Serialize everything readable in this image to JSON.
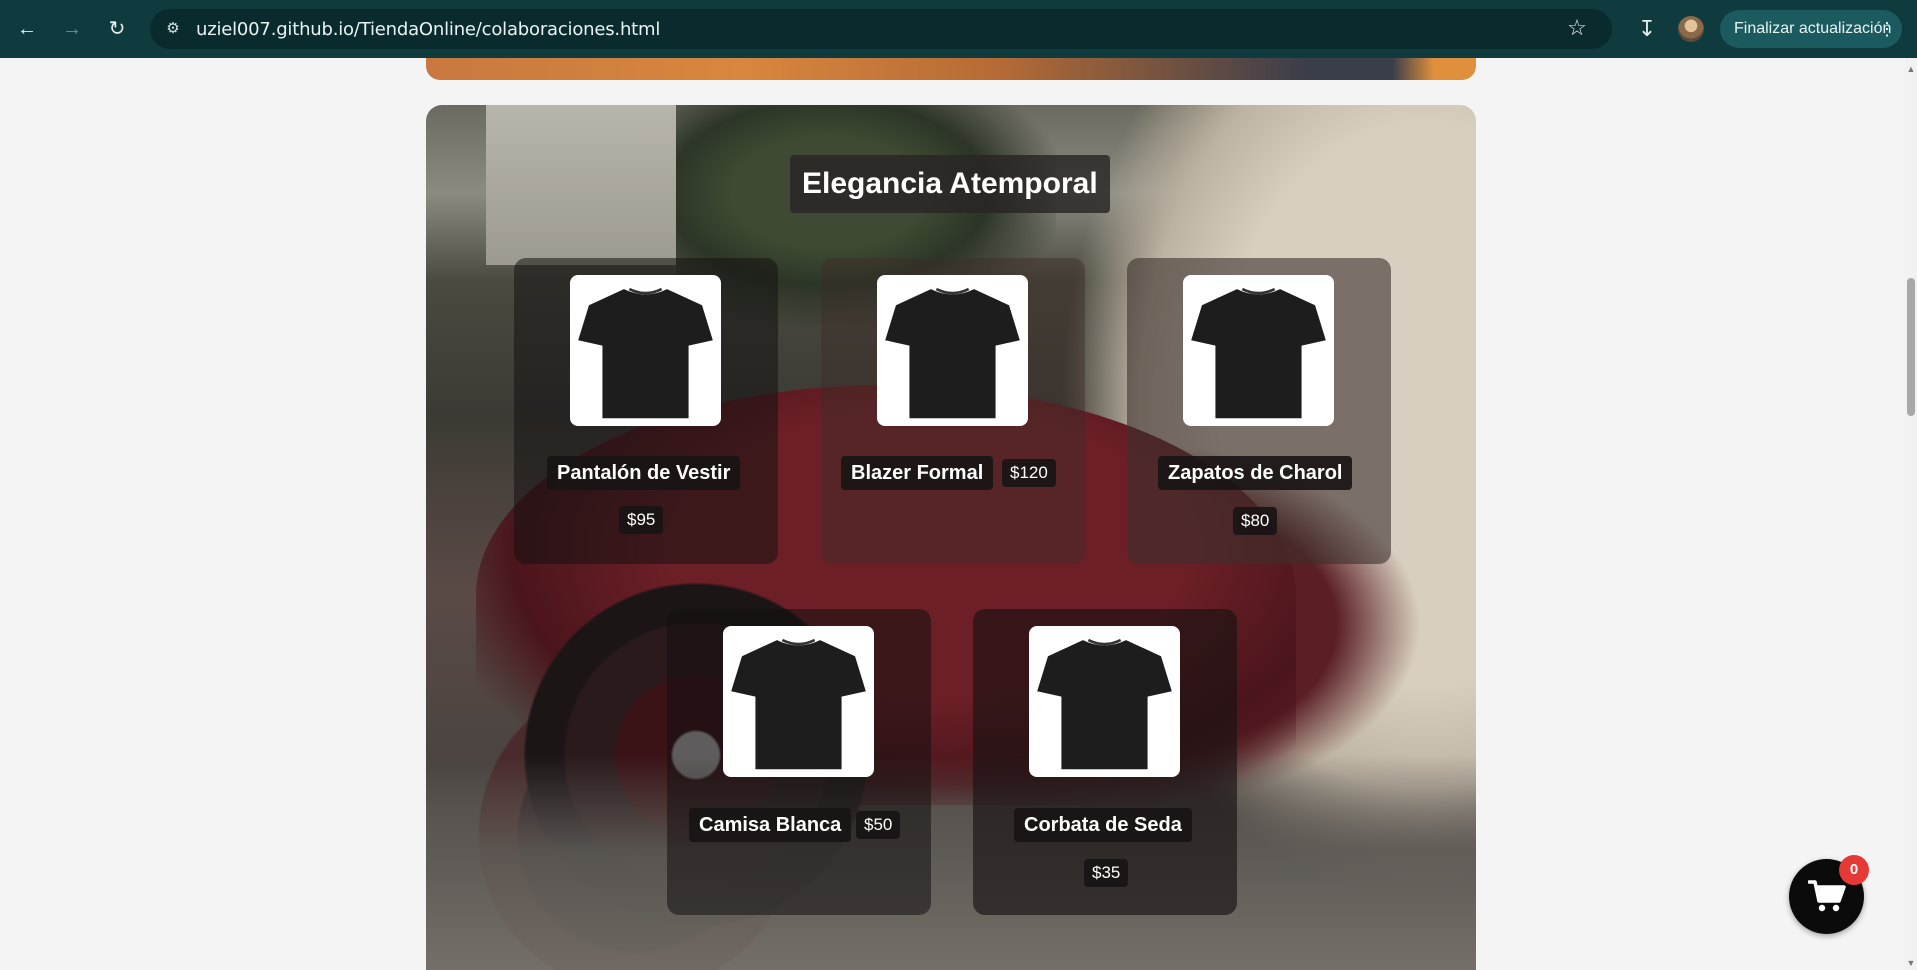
{
  "browser": {
    "back_icon": "arrow-left-icon",
    "forward_icon": "arrow-right-icon",
    "reload_icon": "reload-icon",
    "url": "uziel007.github.io/TiendaOnline/colaboraciones.html",
    "update_label": "Finalizar actualización"
  },
  "collection": {
    "title": "Elegancia Atemporal",
    "products": [
      {
        "name": "Pantalón de Vestir",
        "price": "$95"
      },
      {
        "name": "Blazer Formal",
        "price": "$120"
      },
      {
        "name": "Zapatos de Charol",
        "price": "$80"
      },
      {
        "name": "Camisa Blanca",
        "price": "$50"
      },
      {
        "name": "Corbata de Seda",
        "price": "$35"
      }
    ]
  },
  "cart": {
    "count": "0",
    "badge_color": "#e53935"
  }
}
